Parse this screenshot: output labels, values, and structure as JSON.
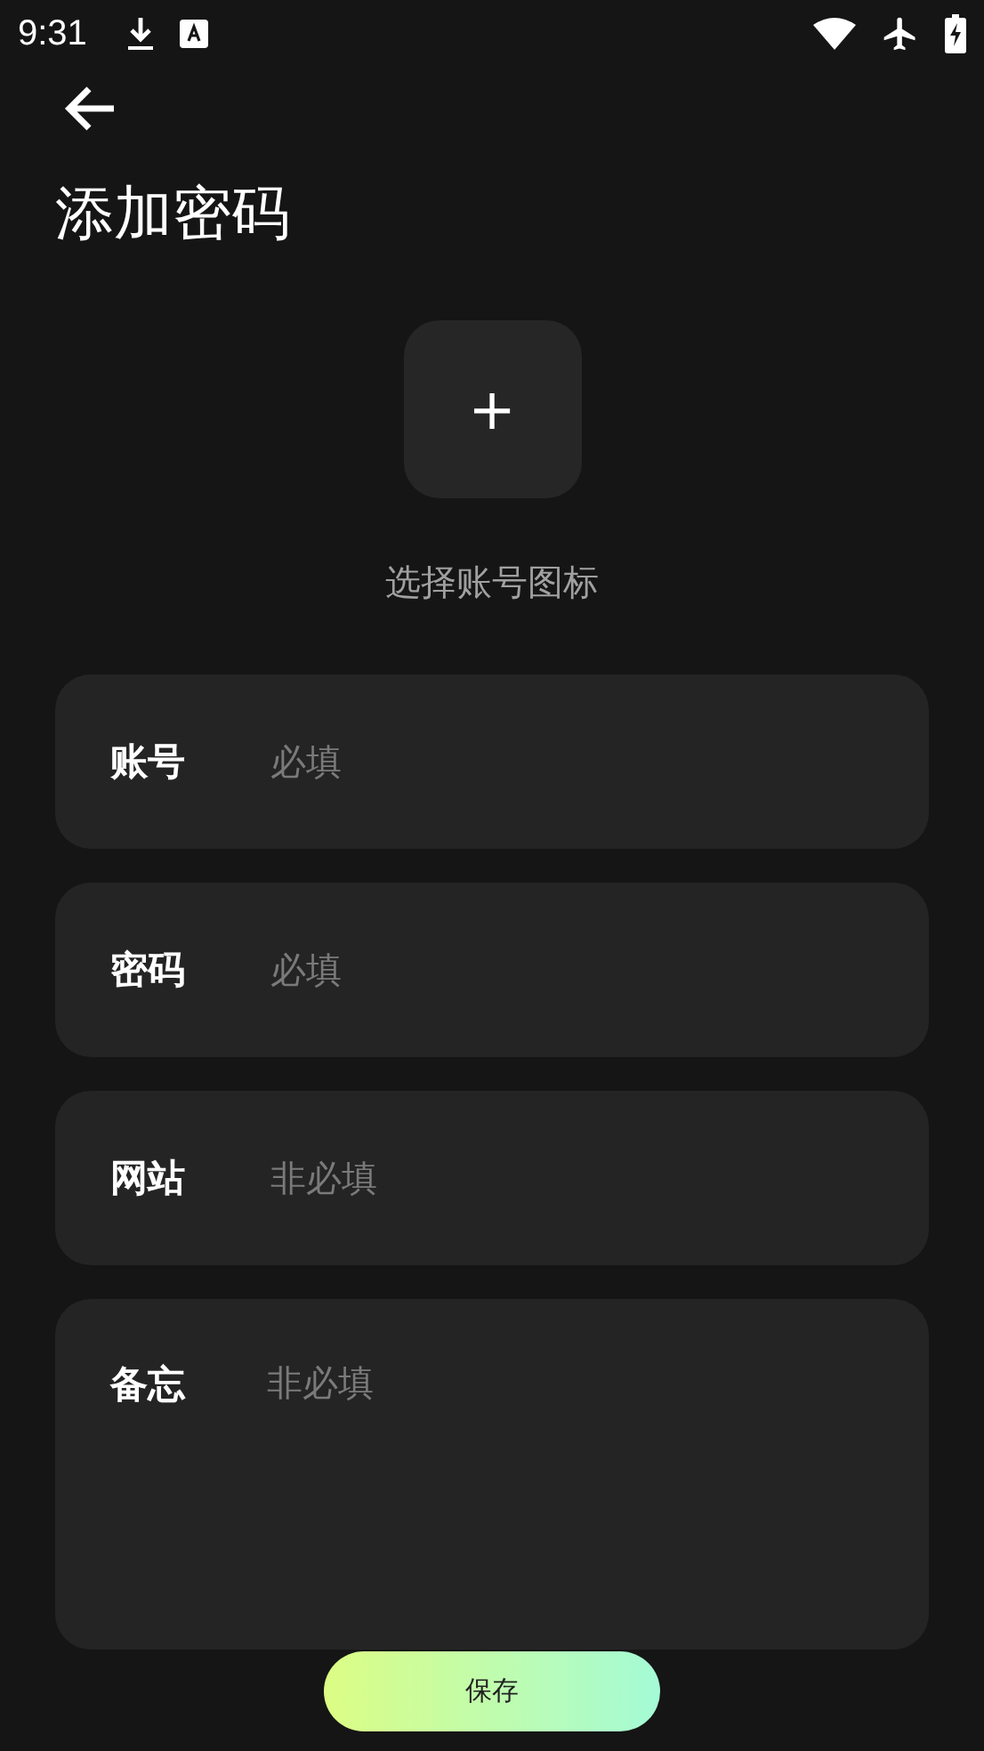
{
  "status_bar": {
    "time": "9:31"
  },
  "title": "添加密码",
  "icon_picker": {
    "symbol": "+",
    "label": "选择账号图标"
  },
  "fields": [
    {
      "label": "账号",
      "placeholder": "必填",
      "kind": "single"
    },
    {
      "label": "密码",
      "placeholder": "必填",
      "kind": "single"
    },
    {
      "label": "网站",
      "placeholder": "非必填",
      "kind": "single"
    },
    {
      "label": "备忘",
      "placeholder": "非必填",
      "kind": "multiline"
    }
  ],
  "save_button": "保存"
}
